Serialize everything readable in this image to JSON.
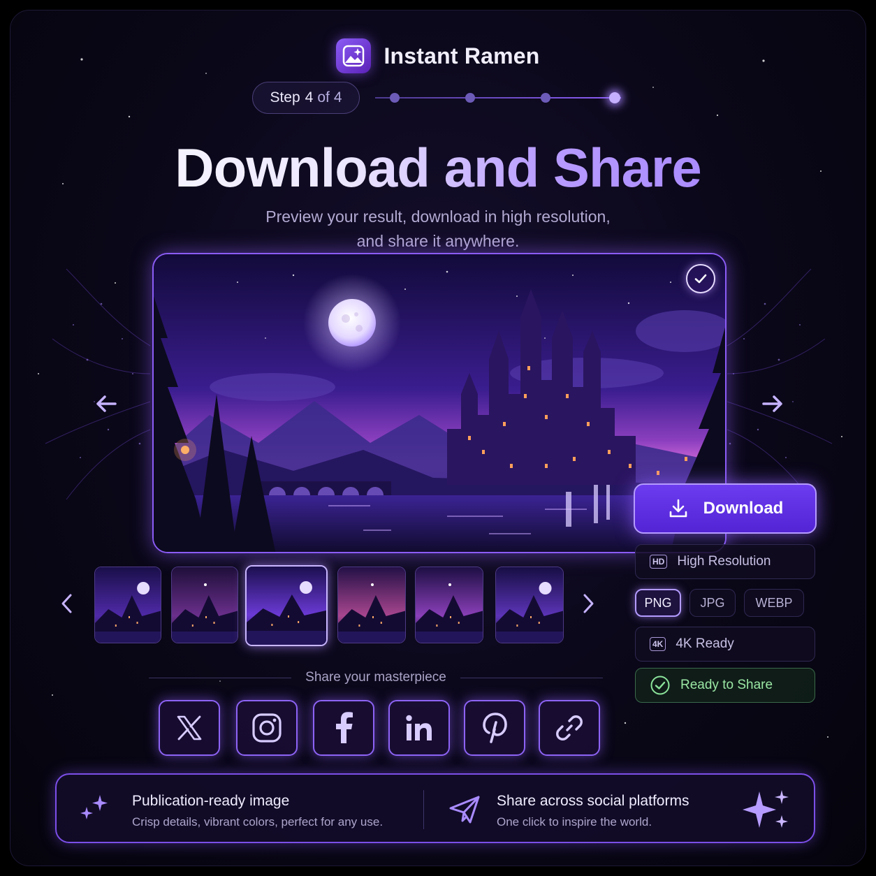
{
  "brand": {
    "name": "Instant Ramen"
  },
  "step": {
    "label": "Step",
    "current": "4",
    "of": "of",
    "total": "4",
    "count": 4,
    "active_index": 3
  },
  "hero": {
    "title": "Download and Share",
    "subtitle_line1": "Preview your result, download in high resolution,",
    "subtitle_line2": "and share it anywhere."
  },
  "preview": {
    "selected": true
  },
  "thumbnails": {
    "count": 6,
    "selected_index": 2
  },
  "download": {
    "button_label": "Download",
    "resolution_tag": "HD",
    "resolution_label": "High Resolution",
    "formats": [
      "PNG",
      "JPG",
      "WEBP"
    ],
    "selected_format": "PNG",
    "fourk_tag": "4K",
    "fourk_label": "4K Ready",
    "ready_label": "Ready to Share"
  },
  "share": {
    "label": "Share your masterpiece",
    "platforms": [
      "x-icon",
      "instagram-icon",
      "facebook-icon",
      "linkedin-icon",
      "pinterest-icon",
      "link-icon"
    ]
  },
  "features": [
    {
      "title": "Publication-ready image",
      "subtitle": "Crisp details, vibrant colors, perfect for any use."
    },
    {
      "title": "Share across social platforms",
      "subtitle": "One click to inspire the world."
    }
  ],
  "colors": {
    "accent": "#8b5cf6",
    "accent_light": "#c4b0ff",
    "ready_green": "#9ae6a4",
    "background": "#0a0718"
  }
}
